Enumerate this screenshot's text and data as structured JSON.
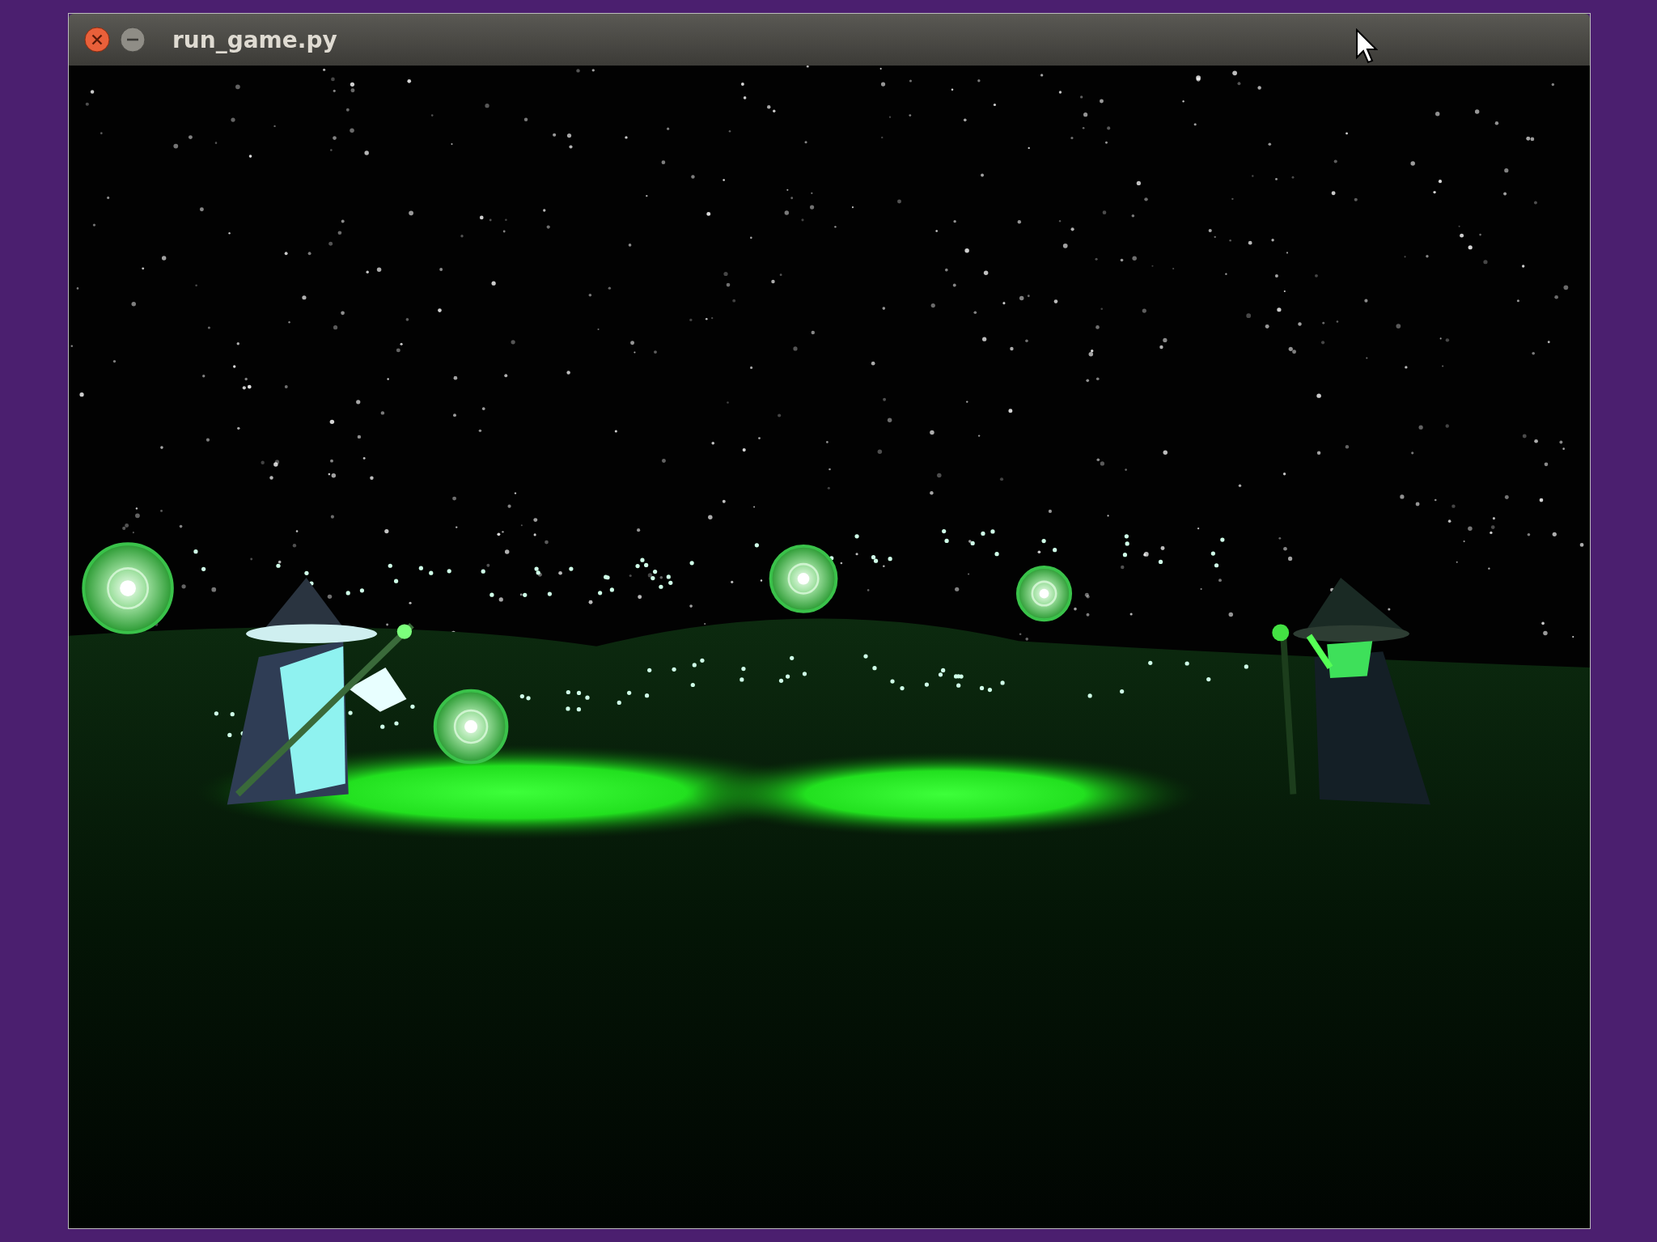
{
  "window": {
    "title": "run_game.py"
  }
}
